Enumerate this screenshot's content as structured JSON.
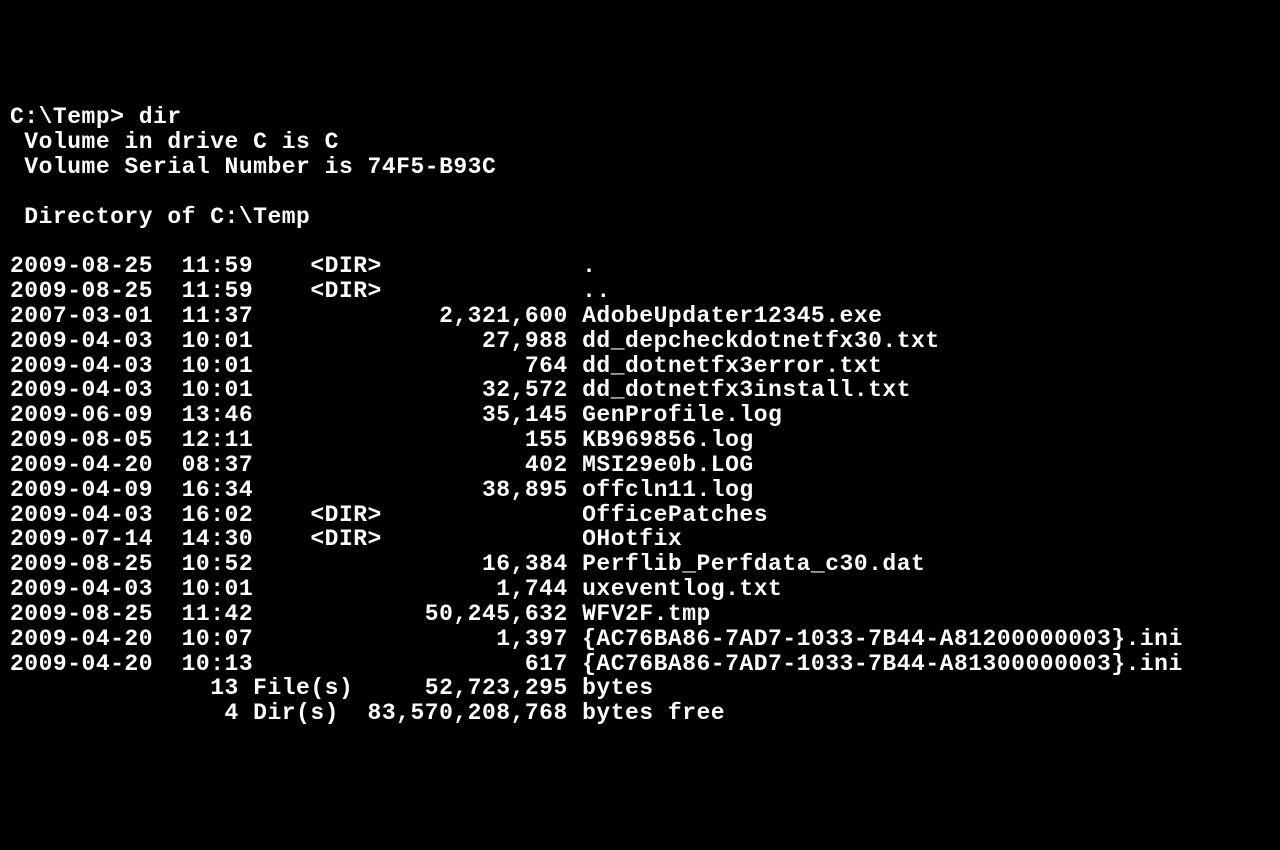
{
  "prompt": "C:\\Temp>",
  "command": "dir",
  "volume_line": " Volume in drive C is C",
  "serial_line": " Volume Serial Number is 74F5-B93C",
  "directory_line": " Directory of C:\\Temp",
  "entries": [
    {
      "date": "2009-08-25",
      "time": "11:59",
      "size_or_type": "<DIR>",
      "name": ".",
      "is_dir": true
    },
    {
      "date": "2009-08-25",
      "time": "11:59",
      "size_or_type": "<DIR>",
      "name": "..",
      "is_dir": true
    },
    {
      "date": "2007-03-01",
      "time": "11:37",
      "size_or_type": "2,321,600",
      "name": "AdobeUpdater12345.exe",
      "is_dir": false
    },
    {
      "date": "2009-04-03",
      "time": "10:01",
      "size_or_type": "27,988",
      "name": "dd_depcheckdotnetfx30.txt",
      "is_dir": false
    },
    {
      "date": "2009-04-03",
      "time": "10:01",
      "size_or_type": "764",
      "name": "dd_dotnetfx3error.txt",
      "is_dir": false
    },
    {
      "date": "2009-04-03",
      "time": "10:01",
      "size_or_type": "32,572",
      "name": "dd_dotnetfx3install.txt",
      "is_dir": false
    },
    {
      "date": "2009-06-09",
      "time": "13:46",
      "size_or_type": "35,145",
      "name": "GenProfile.log",
      "is_dir": false
    },
    {
      "date": "2009-08-05",
      "time": "12:11",
      "size_or_type": "155",
      "name": "KB969856.log",
      "is_dir": false
    },
    {
      "date": "2009-04-20",
      "time": "08:37",
      "size_or_type": "402",
      "name": "MSI29e0b.LOG",
      "is_dir": false
    },
    {
      "date": "2009-04-09",
      "time": "16:34",
      "size_or_type": "38,895",
      "name": "offcln11.log",
      "is_dir": false
    },
    {
      "date": "2009-04-03",
      "time": "16:02",
      "size_or_type": "<DIR>",
      "name": "OfficePatches",
      "is_dir": true
    },
    {
      "date": "2009-07-14",
      "time": "14:30",
      "size_or_type": "<DIR>",
      "name": "OHotfix",
      "is_dir": true
    },
    {
      "date": "2009-08-25",
      "time": "10:52",
      "size_or_type": "16,384",
      "name": "Perflib_Perfdata_c30.dat",
      "is_dir": false
    },
    {
      "date": "2009-04-03",
      "time": "10:01",
      "size_or_type": "1,744",
      "name": "uxeventlog.txt",
      "is_dir": false
    },
    {
      "date": "2009-08-25",
      "time": "11:42",
      "size_or_type": "50,245,632",
      "name": "WFV2F.tmp",
      "is_dir": false
    },
    {
      "date": "2009-04-20",
      "time": "10:07",
      "size_or_type": "1,397",
      "name": "{AC76BA86-7AD7-1033-7B44-A81200000003}.ini",
      "is_dir": false
    },
    {
      "date": "2009-04-20",
      "time": "10:13",
      "size_or_type": "617",
      "name": "{AC76BA86-7AD7-1033-7B44-A81300000003}.ini",
      "is_dir": false
    }
  ],
  "summary": {
    "file_count": "13",
    "file_label": "File(s)",
    "file_bytes": "52,723,295",
    "file_bytes_label": "bytes",
    "dir_count": "4",
    "dir_label": "Dir(s)",
    "dir_bytes": "83,570,208,768",
    "dir_bytes_label": "bytes free"
  }
}
